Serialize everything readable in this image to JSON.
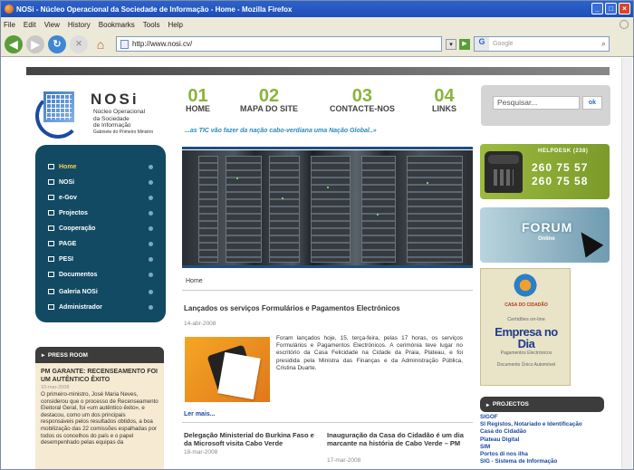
{
  "window": {
    "title": "NOSi - Núcleo Operacional da Sociedade de Informação - Home - Mozilla Firefox"
  },
  "menu": [
    "File",
    "Edit",
    "View",
    "History",
    "Bookmarks",
    "Tools",
    "Help"
  ],
  "toolbar": {
    "url": "http://www.nosi.cv/",
    "search_placeholder": "Google"
  },
  "site": {
    "brand": "NOSi",
    "brand_sub": [
      "Núcleo Operacional",
      "da Sociedade",
      "de Informação"
    ],
    "brand_small": "Gabinete do Primeiro Ministro",
    "tagline": "...as TIC vão fazer da nação cabo-verdiana uma Nação Global..»",
    "nav": [
      {
        "num": "01",
        "label": "HOME"
      },
      {
        "num": "02",
        "label": "MAPA DO SITE"
      },
      {
        "num": "03",
        "label": "CONTACTE-NOS"
      },
      {
        "num": "04",
        "label": "LINKS"
      }
    ],
    "search_placeholder": "Pesquisar...",
    "search_button": "ok"
  },
  "sidebar": {
    "items": [
      "Home",
      "NOSi",
      "e-Gov",
      "Projectos",
      "Cooperação",
      "PAGE",
      "PESI",
      "Documentos",
      "Galeria NOSi",
      "Administrador"
    ]
  },
  "content": {
    "breadcrumb": "Home",
    "article_title": "Lançados os serviços Formulários e Pagamentos Electrónicos",
    "article_date": "14-abr-2008",
    "article_text": "Foram lançados hoje, 15, terça-feira, pelas 17 horas, os serviços Formulários e Pagamentos Electrónicos. A cerimónia teve lugar no escritório da Casa Felicidade na Cidade da Praia, Plateau, e foi presidida pela Ministra das Finanças e da Administração Pública, Cristina Duarte.",
    "read_more": "Ler mais...",
    "news": [
      {
        "title": "Delegação Ministerial do Burkina Faso e da Microsoft visita Cabo Verde",
        "date": "18-mar-2008"
      },
      {
        "title": "Inauguração da Casa do Cidadão é um dia marcante na história de Cabo Verde – PM",
        "date": "17-mar-2008"
      }
    ]
  },
  "press": {
    "header": "PRESS ROOM",
    "title": "PM GARANTE: RECENSEAMENTO FOI UM AUTÊNTICO ÊXITO",
    "date": "10-mar-2008",
    "text": "O primeiro-ministro, José Maria Neves, considerou que o processo de Recenseamento Eleitoral Geral, foi «um autêntico êxito», e destacou, como um dos principais responsáveis pelos resultados obtidos, a boa mobilização das 22 comissões espalhadas por todos os concelhos do país e o papel desempenhado pelas equipas da"
  },
  "helpdesk": {
    "title": "HELPDESK (238)",
    "number1": "260 75 57",
    "number2": "260 75 58"
  },
  "forum": {
    "title": "FORUM",
    "sub": "Online"
  },
  "casa": {
    "title": "CASA DO CIDADÃO",
    "cert": "Certidões on-line",
    "empresa": "Empresa no Dia",
    "pagamentos": "Pagamentos Electrónicos",
    "documento": "Documento Único Automóvel"
  },
  "projects": {
    "header": "PROJECTOS",
    "items": [
      "SIGOF",
      "SI Registos, Notariado e Identificação",
      "Casa do Cidadão",
      "Plateau Digital",
      "SIM",
      "Portos di nos ilha",
      "SIG - Sistema de Informação"
    ]
  }
}
